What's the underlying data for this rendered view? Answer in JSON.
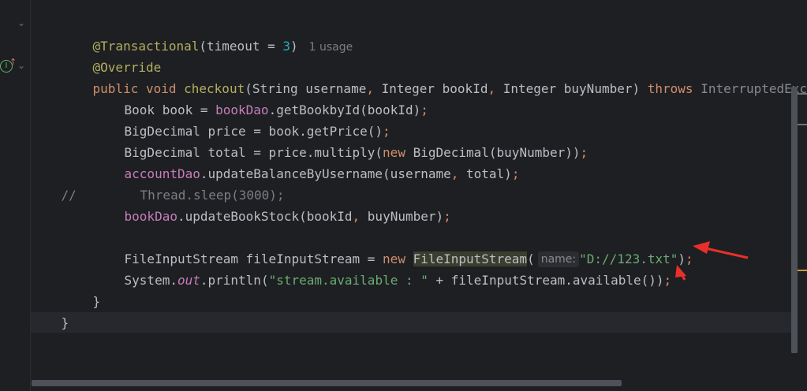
{
  "gutter": {
    "fold_glyph": "⌄",
    "impl_icon_text": "I",
    "impl_arrow_glyph": "↑",
    "comment_prefix": "//"
  },
  "code": {
    "line1": {
      "annotation": "@Transactional",
      "open": "(timeout = ",
      "num": "3",
      "close": ")",
      "usage": "1 usage"
    },
    "line2": {
      "annotation": "@Override"
    },
    "line3": {
      "kw1": "public ",
      "kw2": "void ",
      "name": "checkout",
      "p1": "(String username",
      "comma1": ", ",
      "p2": "Integer bookId",
      "comma2": ", ",
      "p3": "Integer buyNumber) ",
      "throws": "throws ",
      "exc": "InterruptedExc"
    },
    "line4": {
      "a": "Book book = ",
      "field": "bookDao",
      "b": ".getBookbyId(bookId)",
      "semi": ";"
    },
    "line5": {
      "a": "BigDecimal price = book.getPrice()",
      "semi": ";"
    },
    "line6": {
      "a": "BigDecimal total = price.multiply(",
      "kw": "new ",
      "b": "BigDecimal(buyNumber))",
      "semi": ";"
    },
    "line7": {
      "field": "accountDao",
      "a": ".updateBalanceByUsername(username",
      "comma": ", ",
      "b": "total)",
      "semi": ";"
    },
    "line8": {
      "text": "Thread.sleep(3000);"
    },
    "line9": {
      "field": "bookDao",
      "a": ".updateBookStock(bookId",
      "comma": ", ",
      "b": "buyNumber)",
      "semi": ";"
    },
    "line11": {
      "a": "FileInputStream fileInputStream = ",
      "kw": "new ",
      "cls": "FileInputStream",
      "paren": "(",
      "hint": "name:",
      "str": "\"D://123.txt\"",
      "close": ")",
      "semi": ";"
    },
    "line12": {
      "a": "System.",
      "out": "out",
      "b": ".println(",
      "str": "\"stream.available : \"",
      "c": " + fileInputStream.available())",
      "semi": ";"
    },
    "line13": {
      "text": "}"
    },
    "line14": {
      "text": "}"
    }
  },
  "colors": {
    "background": "#1e1f22",
    "keyword": "#cf8e6d",
    "annotation": "#b3ae60",
    "string": "#6aab73",
    "number": "#2aacb8",
    "field": "#c77dbb",
    "arrow": "#e8302a"
  }
}
